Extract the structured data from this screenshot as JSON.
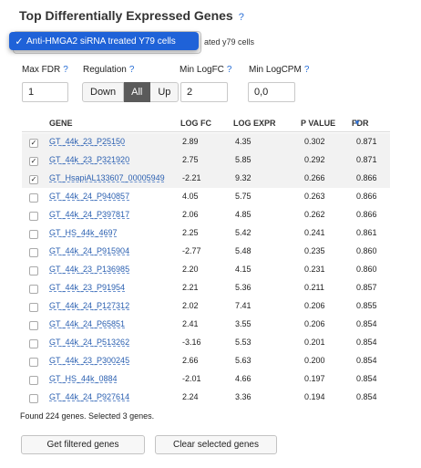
{
  "title": "Top Differentially Expressed Genes",
  "title_help": "?",
  "dropdown": {
    "selected": "Anti-HMGA2 siRNA treated Y79 cells",
    "check": "✓",
    "behind_text": "ated y79 cells"
  },
  "filters": {
    "max_fdr_label": "Max FDR",
    "max_fdr_help": "?",
    "max_fdr_value": "1",
    "regulation_label": "Regulation",
    "regulation_help": "?",
    "regulation_options": [
      "Down",
      "All",
      "Up"
    ],
    "regulation_selected": "All",
    "min_logfc_label": "Min LogFC",
    "min_logfc_help": "?",
    "min_logfc_value": "2",
    "min_logcpm_label": "Min LogCPM",
    "min_logcpm_help": "?",
    "min_logcpm_value": "0,0"
  },
  "table": {
    "columns": [
      "GENE",
      "LOG FC",
      "LOG EXPR",
      "P VALUE",
      "FDR"
    ],
    "sort_indicator": "▼",
    "rows": [
      {
        "selected": true,
        "gene": "GT_44k_23_P25150",
        "logfc": "2.89",
        "logexpr": "4.35",
        "pvalue": "0.302",
        "fdr": "0.871"
      },
      {
        "selected": true,
        "gene": "GT_44k_23_P321920",
        "logfc": "2.75",
        "logexpr": "5.85",
        "pvalue": "0.292",
        "fdr": "0.871"
      },
      {
        "selected": true,
        "gene": "GT_HsapiAL133607_00005949",
        "logfc": "-2.21",
        "logexpr": "9.32",
        "pvalue": "0.266",
        "fdr": "0.866"
      },
      {
        "selected": false,
        "gene": "GT_44k_24_P940857",
        "logfc": "4.05",
        "logexpr": "5.75",
        "pvalue": "0.263",
        "fdr": "0.866"
      },
      {
        "selected": false,
        "gene": "GT_44k_24_P397817",
        "logfc": "2.06",
        "logexpr": "4.85",
        "pvalue": "0.262",
        "fdr": "0.866"
      },
      {
        "selected": false,
        "gene": "GT_HS_44k_4697",
        "logfc": "2.25",
        "logexpr": "5.42",
        "pvalue": "0.241",
        "fdr": "0.861"
      },
      {
        "selected": false,
        "gene": "GT_44k_24_P915904",
        "logfc": "-2.77",
        "logexpr": "5.48",
        "pvalue": "0.235",
        "fdr": "0.860"
      },
      {
        "selected": false,
        "gene": "GT_44k_23_P136985",
        "logfc": "2.20",
        "logexpr": "4.15",
        "pvalue": "0.231",
        "fdr": "0.860"
      },
      {
        "selected": false,
        "gene": "GT_44k_23_P91954",
        "logfc": "2.21",
        "logexpr": "5.36",
        "pvalue": "0.211",
        "fdr": "0.857"
      },
      {
        "selected": false,
        "gene": "GT_44k_24_P127312",
        "logfc": "2.02",
        "logexpr": "7.41",
        "pvalue": "0.206",
        "fdr": "0.855"
      },
      {
        "selected": false,
        "gene": "GT_44k_24_P65851",
        "logfc": "2.41",
        "logexpr": "3.55",
        "pvalue": "0.206",
        "fdr": "0.854"
      },
      {
        "selected": false,
        "gene": "GT_44k_24_P513262",
        "logfc": "-3.16",
        "logexpr": "5.53",
        "pvalue": "0.201",
        "fdr": "0.854"
      },
      {
        "selected": false,
        "gene": "GT_44k_23_P300245",
        "logfc": "2.66",
        "logexpr": "5.63",
        "pvalue": "0.200",
        "fdr": "0.854"
      },
      {
        "selected": false,
        "gene": "GT_HS_44k_0884",
        "logfc": "-2.01",
        "logexpr": "4.66",
        "pvalue": "0.197",
        "fdr": "0.854"
      },
      {
        "selected": false,
        "gene": "GT_44k_24_P927614",
        "logfc": "2.24",
        "logexpr": "3.36",
        "pvalue": "0.194",
        "fdr": "0.854"
      }
    ]
  },
  "summary": "Found 224 genes. Selected 3 genes.",
  "buttons": {
    "get_filtered": "Get filtered genes",
    "clear_selected": "Clear selected genes"
  },
  "colors": {
    "accent": "#1f62d8",
    "link": "#2a5fb0",
    "active_toggle": "#5a5a5a"
  }
}
